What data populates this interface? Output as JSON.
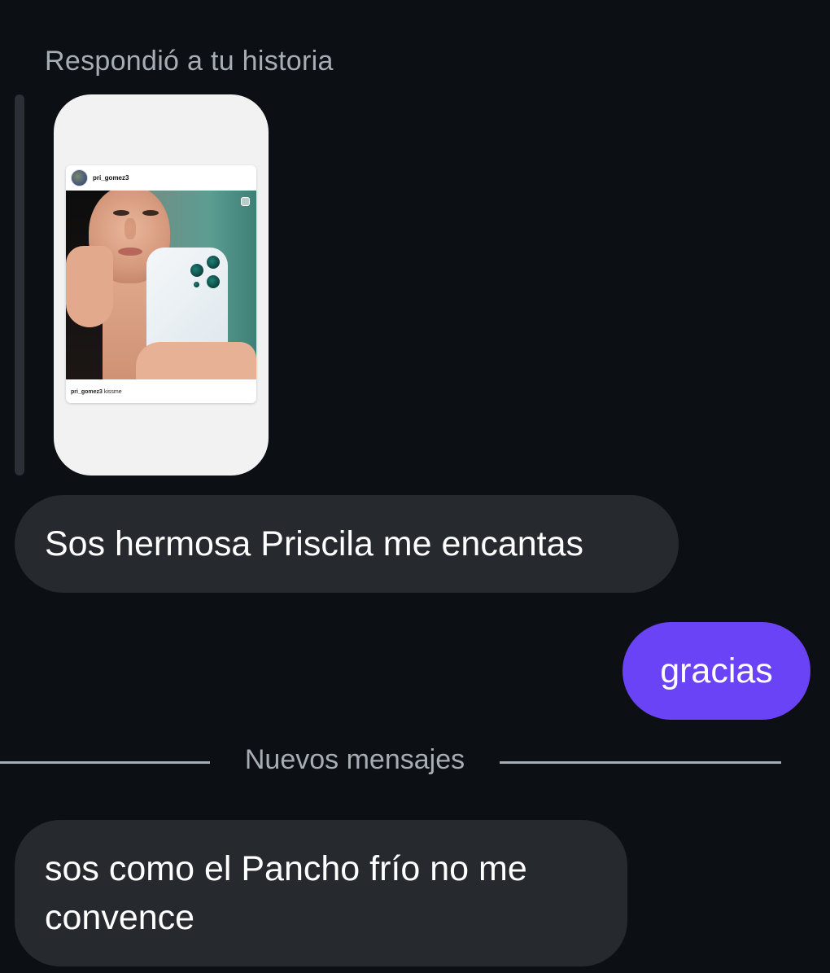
{
  "reply_context": {
    "label": "Respondió a tu historia"
  },
  "story_preview": {
    "username": "pri_gomez3",
    "caption_user": "pri_gomez3",
    "caption_text": "kissme"
  },
  "messages": [
    {
      "direction": "received",
      "text": "Sos hermosa Priscila me encantas"
    },
    {
      "direction": "sent",
      "text": "gracias"
    },
    {
      "direction": "received",
      "text": "sos como el Pancho frío no me convence"
    }
  ],
  "divider": {
    "label": "Nuevos mensajes"
  },
  "colors": {
    "background": "#0c1014",
    "received_bubble": "#262a2f",
    "sent_bubble": "#6a43f7",
    "muted_text": "#a7adb5"
  }
}
